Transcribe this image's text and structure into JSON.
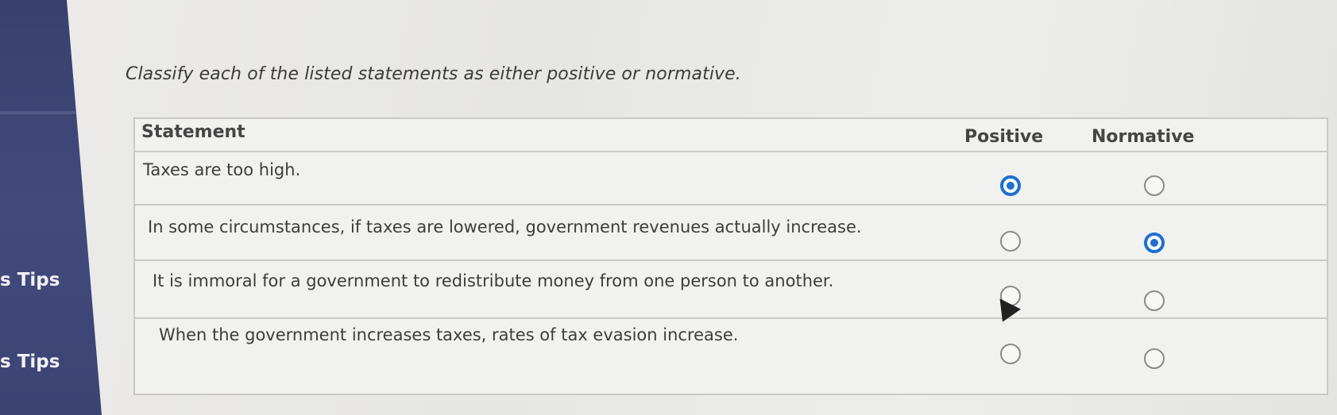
{
  "sidebar": {
    "tips_labels": [
      "s Tips",
      "s Tips"
    ]
  },
  "question": {
    "instruction": "Classify each of the listed statements as either positive or normative."
  },
  "table": {
    "headers": {
      "statement": "Statement",
      "positive": "Positive",
      "normative": "Normative"
    },
    "rows": [
      {
        "statement": "Taxes are too high.",
        "selected": "positive"
      },
      {
        "statement": "In some circumstances, if taxes are lowered, government revenues actually increase.",
        "selected": "normative"
      },
      {
        "statement": "It is immoral for a government to redistribute money from one person to another.",
        "selected": ""
      },
      {
        "statement": "When the government increases taxes, rates of tax evasion increase.",
        "selected": ""
      }
    ]
  },
  "colors": {
    "sidebar": "#3c4474",
    "radio_selected": "#1e6fd0",
    "table_border": "#c9c9c6"
  },
  "icons": {
    "cursor": "mouse-pointer-icon"
  }
}
